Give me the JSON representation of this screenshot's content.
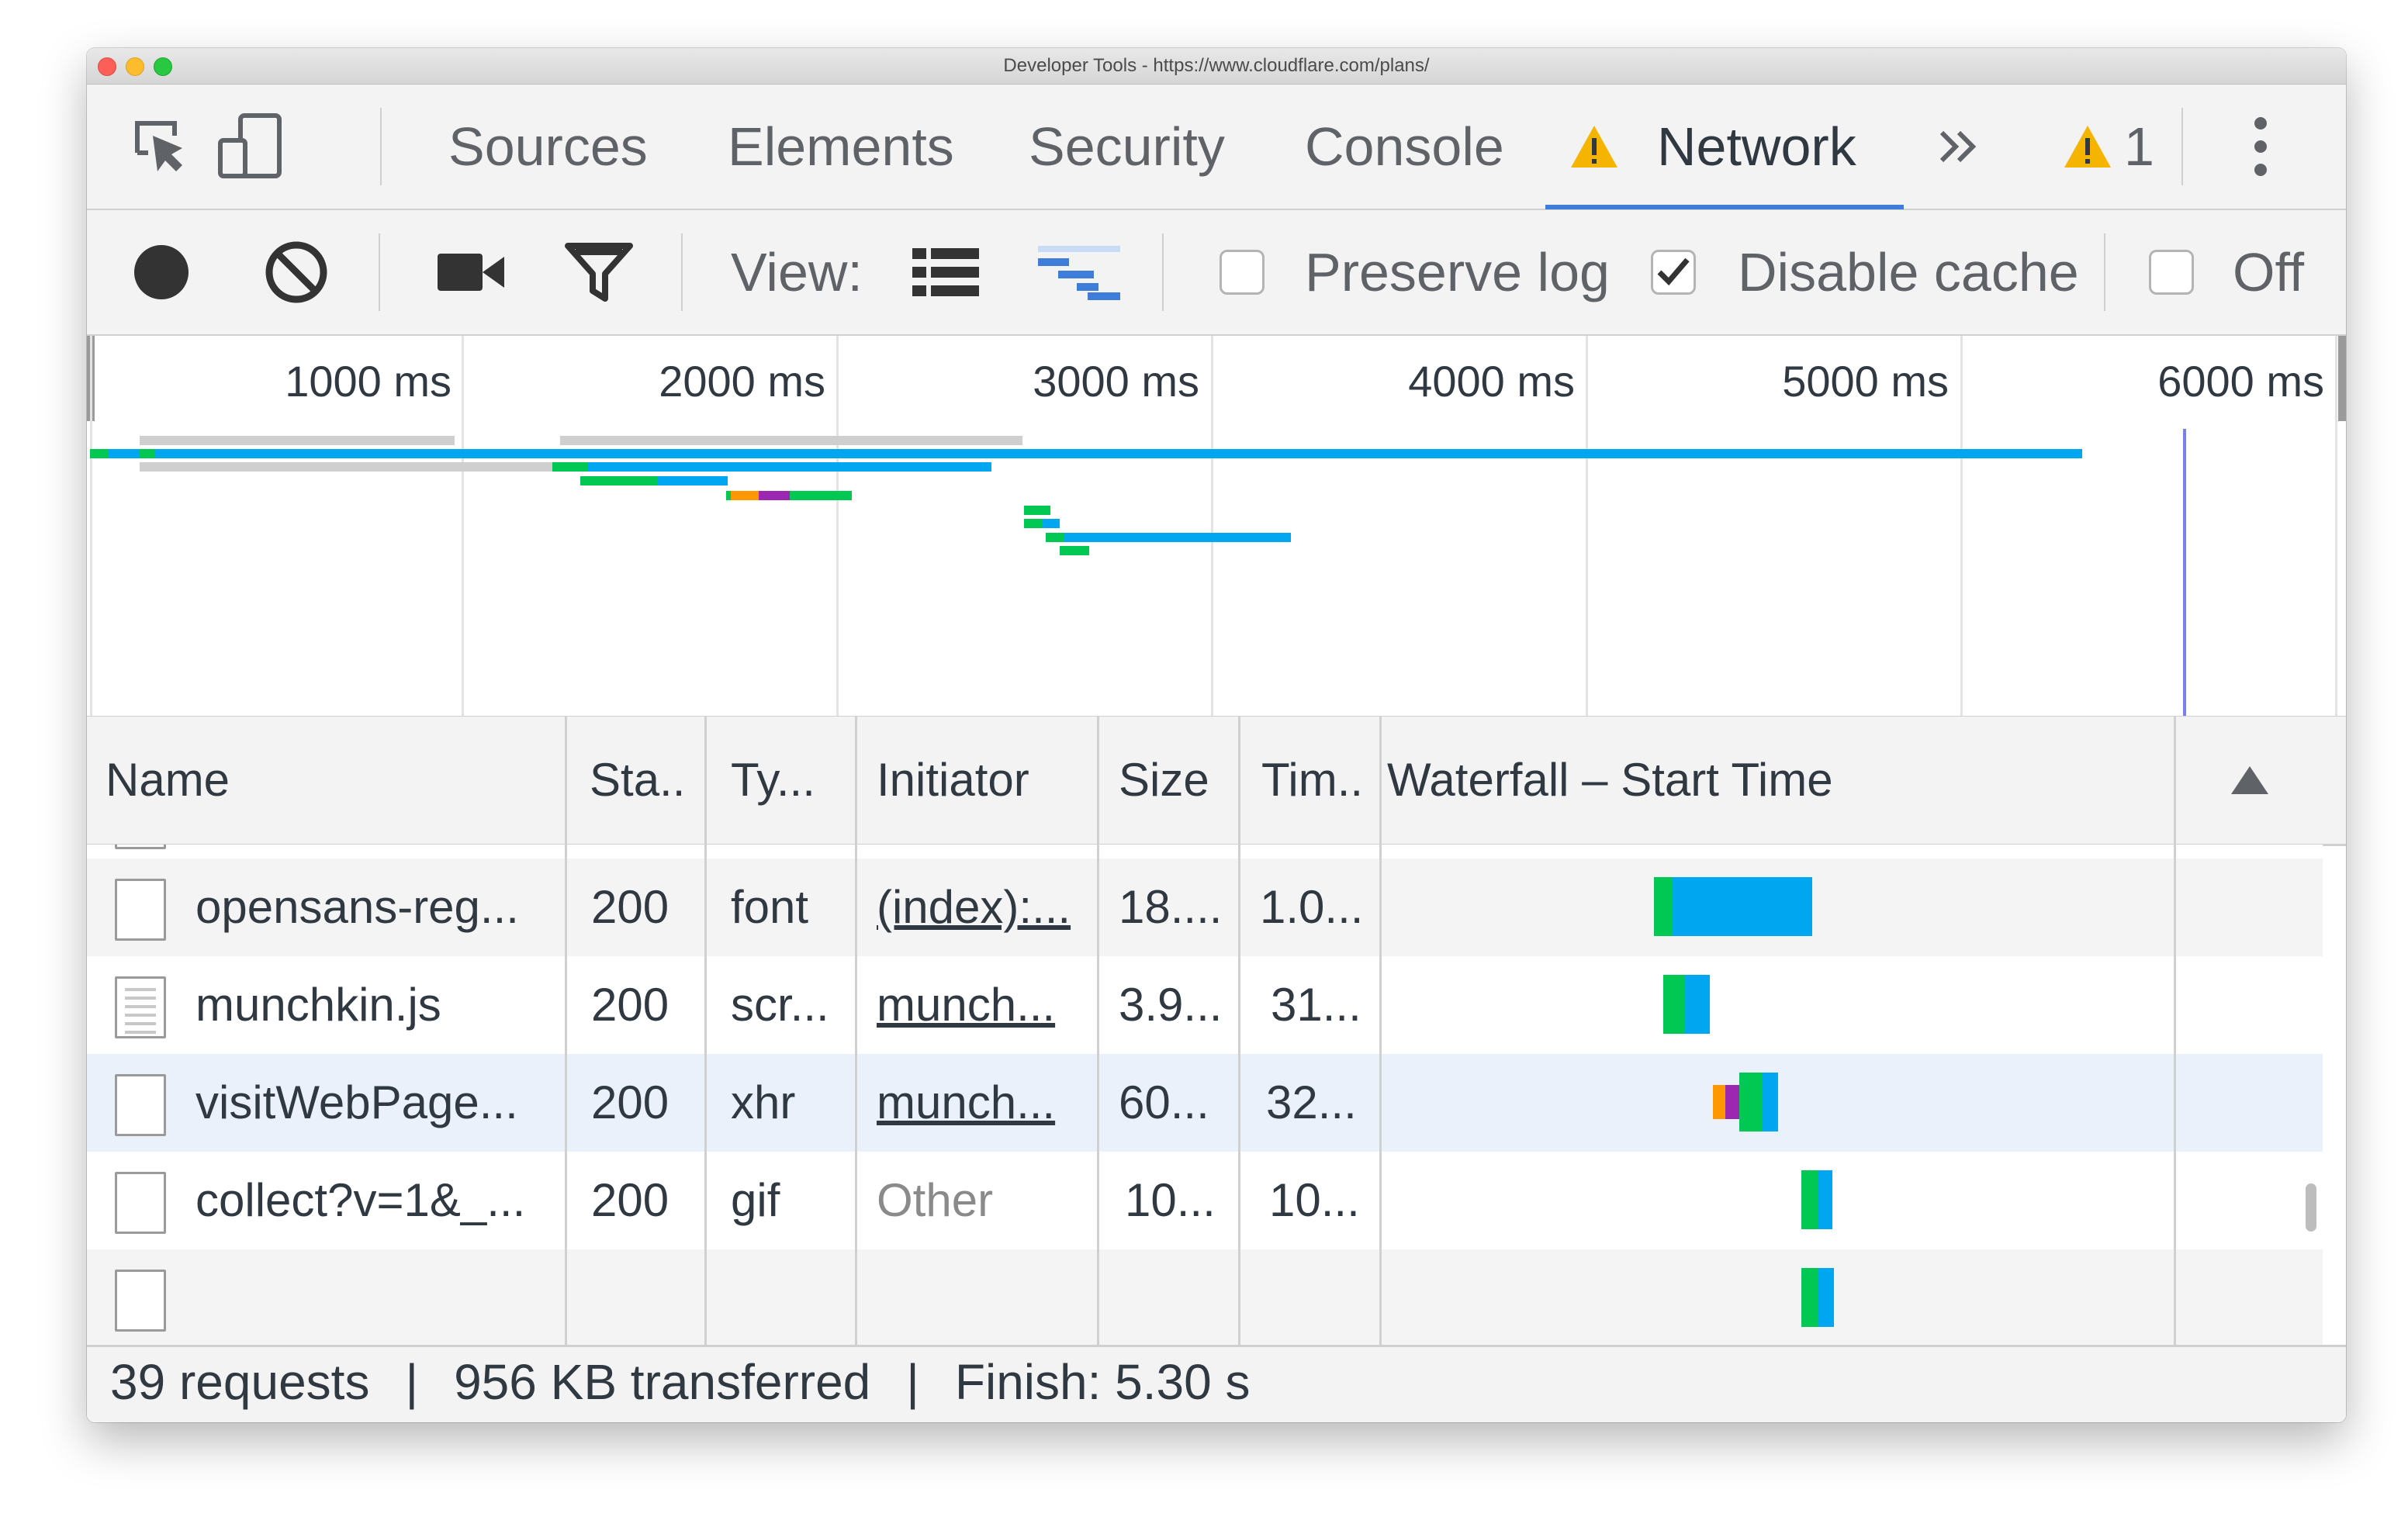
{
  "window": {
    "title": "Developer Tools - https://www.cloudflare.com/plans/"
  },
  "tabs": [
    {
      "label": "Sources",
      "active": false
    },
    {
      "label": "Elements",
      "active": false
    },
    {
      "label": "Security",
      "active": false
    },
    {
      "label": "Console",
      "active": false
    },
    {
      "label": "Network",
      "active": true,
      "warning": true
    }
  ],
  "tabbar": {
    "more_icon": "chevron-double-right-icon",
    "warning_count": "1",
    "menu_icon": "kebab-menu-icon"
  },
  "toolbar": {
    "view_label": "View:",
    "preserve_log": {
      "label": "Preserve log",
      "checked": false
    },
    "disable_cache": {
      "label": "Disable cache",
      "checked": true
    },
    "offline": {
      "label": "Off",
      "checked": false
    }
  },
  "overview": {
    "ticks": [
      "1000 ms",
      "2000 ms",
      "3000 ms",
      "4000 ms",
      "5000 ms",
      "6000 ms"
    ]
  },
  "table": {
    "columns": [
      "Name",
      "Sta..",
      "Ty...",
      "Initiator",
      "Size",
      "Tim..",
      "Waterfall – Start Time"
    ],
    "sort_icon": "sort-ascending-triangle-icon",
    "rows": [
      {
        "name": "opensans-reg...",
        "status": "200",
        "type": "font",
        "initiator": "(index):...",
        "initiator_link": true,
        "size": "18....",
        "time": "1.0...",
        "icon": "document-icon"
      },
      {
        "name": "munchkin.js",
        "status": "200",
        "type": "scr...",
        "initiator": "munch...",
        "initiator_link": true,
        "size": "3.9...",
        "time": "31...",
        "icon": "script-file-icon"
      },
      {
        "name": "visitWebPage...",
        "status": "200",
        "type": "xhr",
        "initiator": "munch...",
        "initiator_link": true,
        "size": "60...",
        "time": "32...",
        "icon": "document-icon",
        "selected": true
      },
      {
        "name": "collect?v=1&_...",
        "status": "200",
        "type": "gif",
        "initiator": "Other",
        "initiator_link": false,
        "size": "10...",
        "time": "10...",
        "icon": "document-icon"
      }
    ]
  },
  "status": {
    "requests": "39 requests",
    "transferred": "956 KB transferred",
    "finish": "Finish: 5.30 s"
  },
  "colors": {
    "accent": "#3f7ddb",
    "receiving": "#00a6f0",
    "waiting": "#00c853",
    "stalled": "#ff9800",
    "ssl": "#9c27b0",
    "queued": "#cfcfcf",
    "load_line": "#7b7fe6"
  }
}
